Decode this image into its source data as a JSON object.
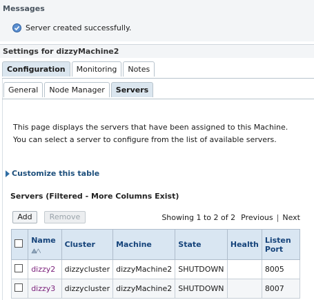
{
  "messages": {
    "title": "Messages",
    "text": "Server created successfully."
  },
  "settings": {
    "title": "Settings for dizzyMachine2"
  },
  "main_tabs": [
    {
      "label": "Configuration",
      "active": true
    },
    {
      "label": "Monitoring",
      "active": false
    },
    {
      "label": "Notes",
      "active": false
    }
  ],
  "sub_tabs": [
    {
      "label": "General",
      "active": false
    },
    {
      "label": "Node Manager",
      "active": false
    },
    {
      "label": "Servers",
      "active": true
    }
  ],
  "description": "This page displays the servers that have been assigned to this Machine. You can select a server to configure from the list of available servers.",
  "customize_label": "Customize this table",
  "table": {
    "title": "Servers (Filtered - More Columns Exist)",
    "add_label": "Add",
    "remove_label": "Remove",
    "showing": "Showing 1 to 2 of 2",
    "previous": "Previous",
    "pipe": "|",
    "next": "Next",
    "headers": [
      "Name",
      "Cluster",
      "Machine",
      "State",
      "Health",
      "Listen Port"
    ],
    "rows": [
      {
        "name": "dizzy2",
        "cluster": "dizzycluster",
        "machine": "dizzyMachine2",
        "state": "SHUTDOWN",
        "health": "",
        "port": "8005"
      },
      {
        "name": "dizzy3",
        "cluster": "dizzycluster",
        "machine": "dizzyMachine2",
        "state": "SHUTDOWN",
        "health": "",
        "port": "8007"
      }
    ]
  },
  "colors": {
    "accent": "#1d4f7c",
    "header_bg": "#d9e6f2",
    "link_visited": "#7a1f7a"
  }
}
